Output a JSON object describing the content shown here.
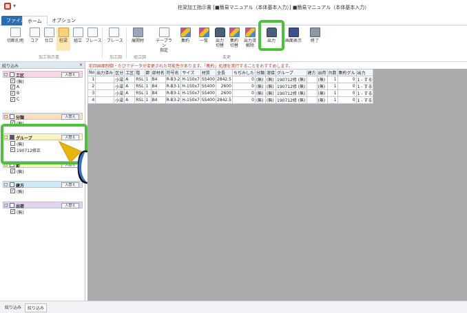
{
  "window": {
    "title": "柱梁加工指示書 [■簡易マニュアル（本体基本入力）] ■簡易マニュアル（本体基本入力）",
    "quick_access": "▾"
  },
  "menu": {
    "file": "ファイル",
    "home": "ホーム",
    "options": "オプション"
  },
  "ribbon": {
    "buttons": [
      {
        "id": "setsudan",
        "label": "切断孔明"
      },
      {
        "id": "core",
        "label": "コア"
      },
      {
        "id": "shiguchi",
        "label": "仕口"
      },
      {
        "id": "hashira",
        "label": "柱梁"
      },
      {
        "id": "kumitate",
        "label": "組立"
      },
      {
        "id": "brace1",
        "label": "ブレース"
      },
      {
        "id": "brace2",
        "label": "ブレース"
      },
      {
        "id": "tenkaizai",
        "label": "展開材"
      },
      {
        "id": "tape",
        "label": "テープラン\n指定"
      },
      {
        "id": "shuyaku",
        "label": "集約"
      },
      {
        "id": "ichiran",
        "label": "一覧"
      },
      {
        "id": "out_kirikae",
        "label": "出力\n切替"
      },
      {
        "id": "shuyaku_kirikae",
        "label": "集約\n切替"
      },
      {
        "id": "out_kaijo",
        "label": "出力済\n解除"
      },
      {
        "id": "shutsuryoku",
        "label": "出力"
      },
      {
        "id": "gamen",
        "label": "画面表示"
      },
      {
        "id": "shuryo",
        "label": "終了"
      }
    ],
    "groups": {
      "kako": "加工指示書",
      "kakozu": "加工図",
      "kumitate": "組立図",
      "henko": "変更"
    }
  },
  "left_panel": {
    "title": "絞り込み",
    "close": "×",
    "sections": [
      {
        "name": "工区",
        "button": "入替え",
        "items": [
          "(無)",
          "A",
          "B",
          "C"
        ]
      },
      {
        "name": "分類",
        "button": "入替え",
        "items": [
          "(無)"
        ]
      },
      {
        "name": "グループ",
        "button": "入替え",
        "items": [
          "(無)",
          "190712修正"
        ]
      },
      {
        "name": "節",
        "button": "入替え",
        "items": [
          "(無)"
        ]
      },
      {
        "name": "建方",
        "button": "入替え",
        "items": [
          "(無)"
        ]
      },
      {
        "name": "出荷",
        "button": "入替え",
        "items": [
          "(無)"
        ]
      }
    ]
  },
  "notice": "前回画面制御・たびでデータが変更された可能性があります。「集約」処理を実行することをおすすめします。",
  "table": {
    "headers": [
      "No",
      "出力済み",
      "区分",
      "工区",
      "階",
      "節",
      "部材名",
      "符号名",
      "サイズ",
      "材質",
      "全長",
      "ちぢみした",
      "分類",
      "溶接",
      "グループ",
      "建方",
      "出荷",
      "台数",
      "集約グル",
      "出力"
    ],
    "rows": [
      [
        "1",
        "",
        "小梁",
        "A",
        "RSL",
        "1",
        "B4",
        "R-B3-2",
        "H-150x7",
        "SS400",
        "2842.5",
        "0",
        "(無)",
        "(無)",
        "190712修 (無)",
        "",
        "(無)",
        "1",
        "0",
        "1 - する"
      ],
      [
        "2",
        "",
        "小梁",
        "A",
        "RSL",
        "1",
        "B4",
        "R-B3-1",
        "H-150x7",
        "SS400",
        "2600",
        "0",
        "(無)",
        "(無)",
        "190712修 (無)",
        "",
        "(無)",
        "1",
        "0",
        "1 - する"
      ],
      [
        "3",
        "",
        "小梁",
        "A",
        "RSL",
        "1",
        "B4",
        "R-B3-1",
        "H-150x7",
        "SS400",
        "2600",
        "0",
        "(無)",
        "(無)",
        "190712修 (無)",
        "",
        "(無)",
        "1",
        "0",
        "1 - する"
      ],
      [
        "4",
        "",
        "小梁",
        "A",
        "RSL",
        "1",
        "B4",
        "R-B3-2",
        "H-150x7",
        "SS400",
        "2842.5",
        "0",
        "(無)",
        "(無)",
        "190712修 (無)",
        "",
        "(無)",
        "1",
        "0",
        "1 - する"
      ]
    ]
  },
  "status_tabs": [
    "絞り込み",
    "絞り込み"
  ],
  "colors": {
    "highlight": "#4cc13a",
    "pointer": "#e8b70e",
    "accent": "#2b6cb3",
    "notice": "#c0392b"
  }
}
